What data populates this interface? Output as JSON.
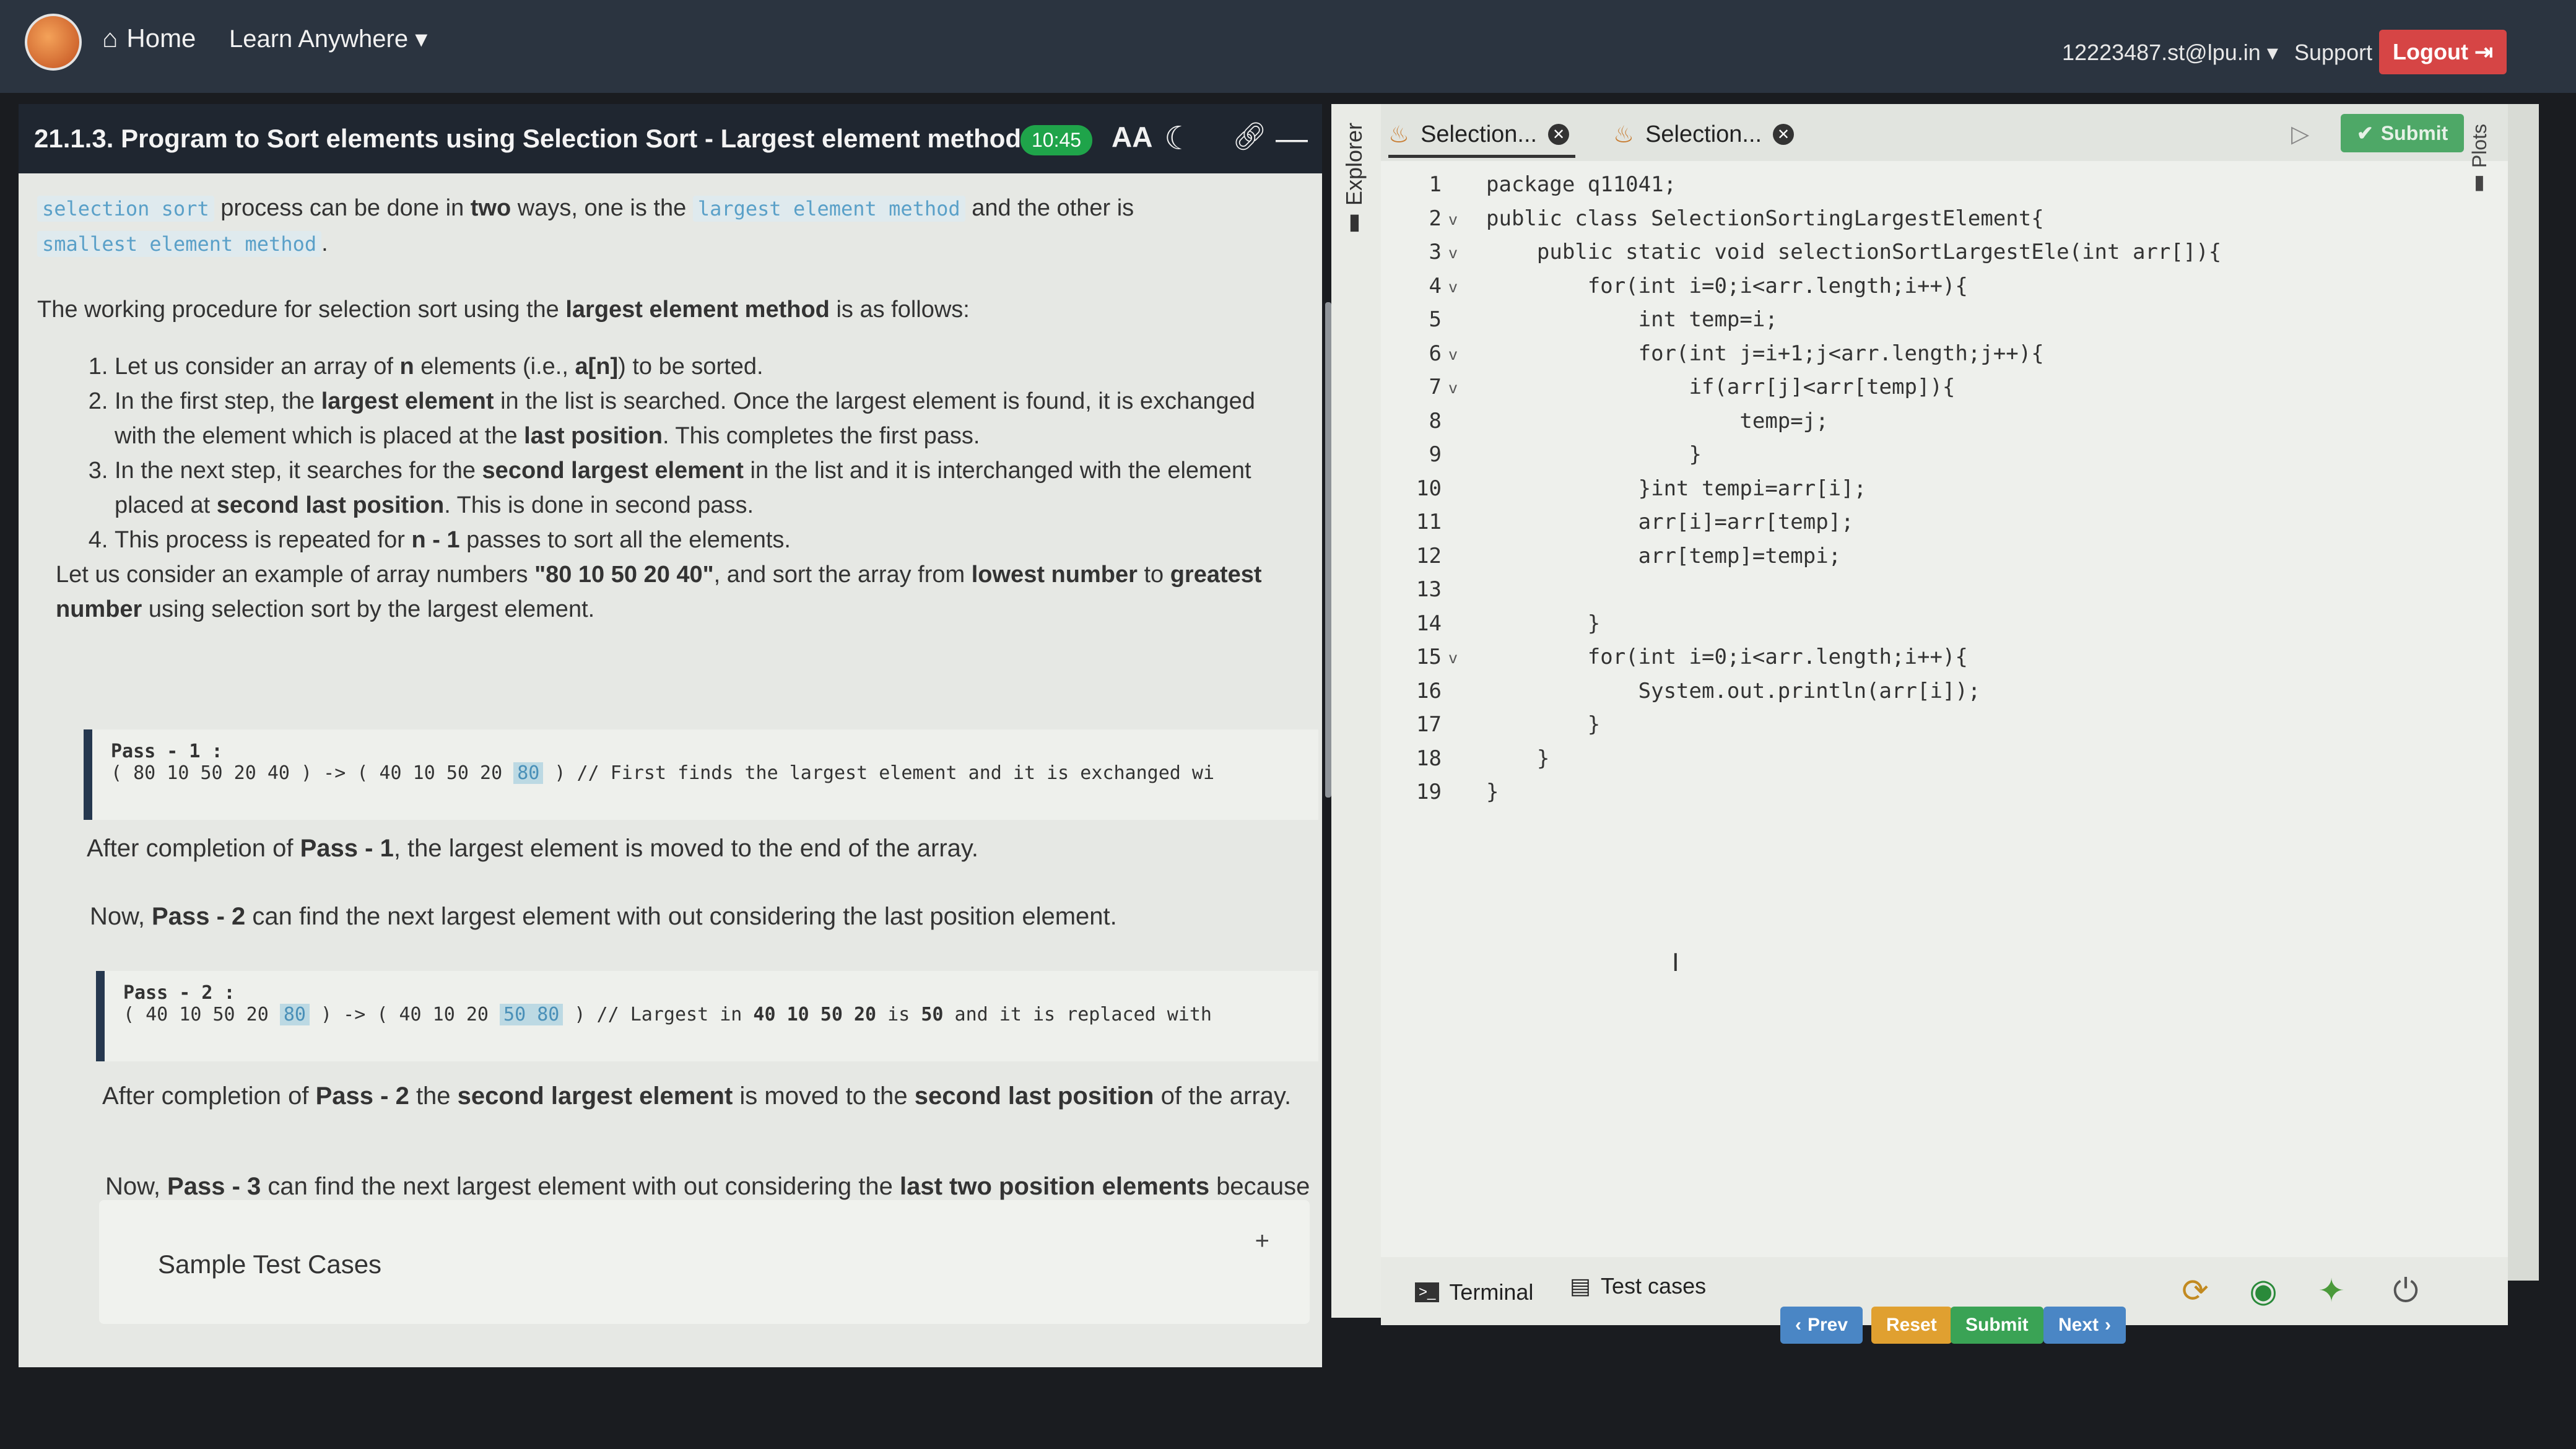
{
  "nav": {
    "home": "Home",
    "learn": "Learn Anywhere",
    "user": "12223487.st@lpu.in",
    "support": "Support",
    "logout": "Logout"
  },
  "lesson": {
    "title": "21.1.3. Program to Sort elements using Selection Sort - Largest element method",
    "timer": "10:45",
    "intro": {
      "tag_selection_sort": "selection sort",
      "t1": " process can be done in ",
      "two": "two",
      "t2": " ways, one is the ",
      "tag_largest": "largest element method",
      "t3": " and the other is",
      "tag_smallest": "smallest element method",
      "t4": "."
    },
    "procedure": {
      "t1": "The working procedure for selection sort using the ",
      "bold": "largest element method",
      "t2": " is as follows:"
    },
    "steps": [
      {
        "a": "Let us consider an array of ",
        "b": "n",
        "c": " elements (i.e., ",
        "d": "a[n]",
        "e": ") to be sorted."
      },
      {
        "a": "In the first step, the ",
        "b": "largest element",
        "c": " in the list is searched. Once the largest element is found, it is exchanged with the element which is placed at the ",
        "d": "last position",
        "e": ". This completes the first pass."
      },
      {
        "a": "In the next step, it searches for the ",
        "b": "second largest element",
        "c": " in the list and it is interchanged with the element placed at ",
        "d": "second last position",
        "e": ". This is done in second pass."
      },
      {
        "a": "This process is repeated for ",
        "b": "n - 1",
        "c": " passes to sort all the elements.",
        "d": "",
        "e": ""
      }
    ],
    "example": {
      "t1": "Let us consider an example of array numbers ",
      "b1": "\"80 10 50 20 40\"",
      "t2": ", and sort the array from ",
      "b2": "lowest number",
      "t3": " to ",
      "b3": "greatest number",
      "t4": " using selection sort by the largest element."
    },
    "pass1": {
      "label": "Pass - 1 :",
      "pre": "( 80 10 50 20 40 ) -> ( 40 10 50 20 ",
      "mark": "80",
      "post": " ) // First finds the largest element and it is exchanged wi"
    },
    "after1": {
      "t1": "After completion of ",
      "b": "Pass - 1",
      "t2": ", the largest element is moved to the end of the array."
    },
    "now2": {
      "t1": "Now, ",
      "b": "Pass - 2",
      "t2": " can find the next largest element with out considering the last position element."
    },
    "pass2": {
      "label": "Pass - 2 :",
      "pre": "( 40 10 50 20 ",
      "mark1": "80",
      "mid": " ) -> ( 40 10 20 ",
      "mark2": "50 80",
      "post1": " ) // Largest in ",
      "b1": "40 10 50 20",
      "post2": " is ",
      "b2": "50",
      "post3": " and it is replaced with"
    },
    "after2": {
      "t1": "After completion of ",
      "b1": "Pass - 2",
      "t2": " the ",
      "b2": "second largest element",
      "t3": " is moved to the ",
      "b3": "second last position",
      "t4": " of the array."
    },
    "now3": {
      "t1": "Now, ",
      "b1": "Pass - 3",
      "t2": " can find the next largest element with out considering the ",
      "b2": "last two position elements",
      "t3": " because they are already sorted."
    },
    "sample": "Sample Test Cases",
    "sample_plus": "+"
  },
  "explorer": {
    "label": "Explorer"
  },
  "plots": {
    "label": "Plots"
  },
  "editor": {
    "tabs": [
      {
        "label": "Selection..."
      },
      {
        "label": "Selection..."
      }
    ],
    "submit": "Submit",
    "lines": [
      "package q11041;",
      "public class SelectionSortingLargestElement{",
      "    public static void selectionSortLargestEle(int arr[]){",
      "        for(int i=0;i<arr.length;i++){",
      "            int temp=i;",
      "            for(int j=i+1;j<arr.length;j++){",
      "                if(arr[j]<arr[temp]){",
      "                    temp=j;",
      "                }",
      "            }int tempi=arr[i];",
      "            arr[i]=arr[temp];",
      "            arr[temp]=tempi;",
      "            ",
      "        }",
      "        for(int i=0;i<arr.length;i++){",
      "            System.out.println(arr[i]);",
      "        }",
      "    }",
      "}"
    ]
  },
  "bottom": {
    "terminal": "Terminal",
    "testcases": "Test cases",
    "prev": "Prev",
    "reset": "Reset",
    "submit": "Submit",
    "next": "Next"
  }
}
